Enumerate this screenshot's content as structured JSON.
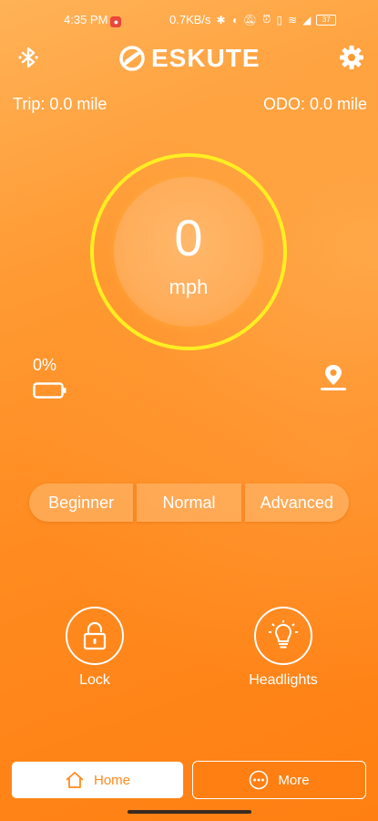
{
  "status_bar": {
    "time": "4:35 PM",
    "net_speed": "0.7KB/s",
    "battery": "37"
  },
  "header": {
    "brand": "ESKUTE"
  },
  "stats": {
    "trip": "Trip: 0.0 mile",
    "odo": "ODO: 0.0 mile"
  },
  "speedometer": {
    "value": "0",
    "unit": "mph"
  },
  "battery": {
    "percent": "0%"
  },
  "modes": [
    {
      "label": "Beginner"
    },
    {
      "label": "Normal"
    },
    {
      "label": "Advanced"
    }
  ],
  "controls": {
    "lock_label": "Lock",
    "headlights_label": "Headlights"
  },
  "bottom_nav": {
    "home_label": "Home",
    "more_label": "More"
  },
  "colors": {
    "accent": "#ff8a1f",
    "ring": "#ffee22"
  },
  "icons": [
    "bluetooth-icon",
    "logo-mark-icon",
    "gear-icon",
    "battery-icon",
    "location-pin-icon",
    "padlock-icon",
    "lightbulb-icon",
    "home-icon",
    "more-dots-icon"
  ]
}
